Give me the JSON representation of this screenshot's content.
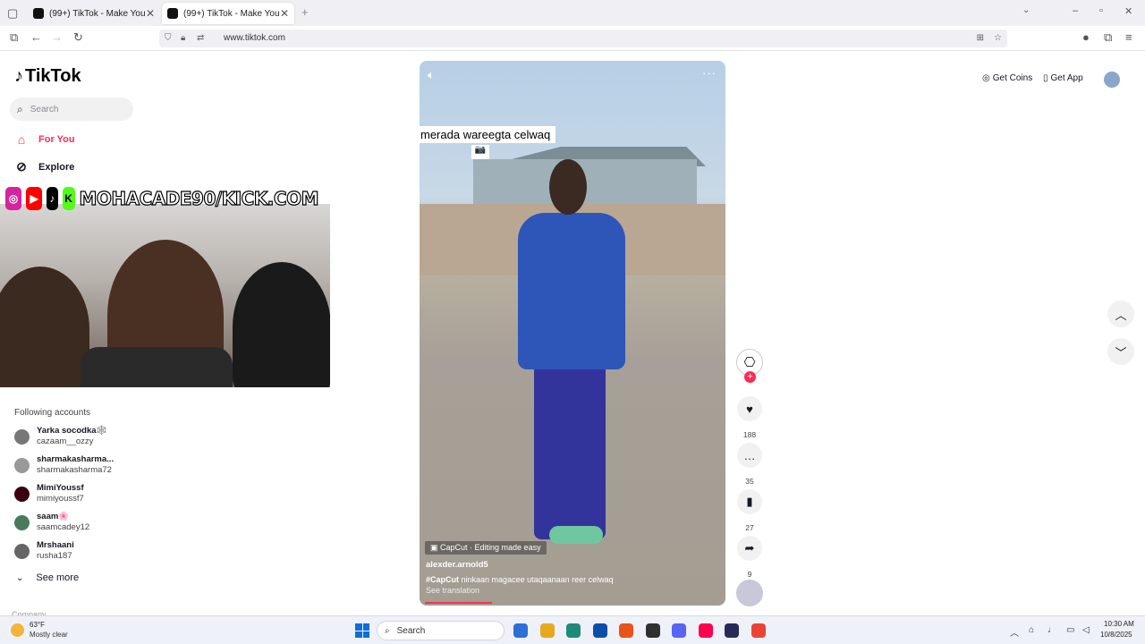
{
  "browser": {
    "tabs": [
      {
        "label": "(99+) TikTok - Make Your Day",
        "active": false
      },
      {
        "label": "(99+) TikTok - Make Your Day",
        "active": true
      }
    ],
    "new_tab": "+",
    "url": "www.tiktok.com"
  },
  "tiktok": {
    "logo": "TikTok",
    "search_placeholder": "Search",
    "nav": [
      {
        "label": "For You",
        "icon": "home-icon"
      },
      {
        "label": "Explore",
        "icon": "compass-icon"
      }
    ],
    "following_title": "Following accounts",
    "accounts": [
      {
        "display": "Yarka socodka🕸️",
        "user": "cazaam__ozzy",
        "color": "#777"
      },
      {
        "display": "sharmakasharma...",
        "user": "sharmakasharma72",
        "color": "#999"
      },
      {
        "display": "MimiYoussf",
        "user": "mimiyoussf7",
        "color": "#3a0010"
      },
      {
        "display": "saam🌸",
        "user": "saamcadey12",
        "color": "#4a7a5a"
      },
      {
        "display": "Mrshaani",
        "user": "rusha187",
        "color": "#666"
      }
    ],
    "see_more": "See more",
    "company": "Company",
    "get_coins": "Get Coins",
    "get_app": "Get App"
  },
  "stream_overlay": {
    "channel": "MOHACADE90/KICK.COM",
    "badges": [
      {
        "name": "instagram-icon",
        "glyph": "◎",
        "color": "#d6249f"
      },
      {
        "name": "youtube-icon",
        "glyph": "▶",
        "color": "#ff0000"
      },
      {
        "name": "tiktok-icon",
        "glyph": "♪",
        "color": "#000000"
      },
      {
        "name": "kick-icon",
        "glyph": "K",
        "color": "#53fc18"
      }
    ]
  },
  "video": {
    "overlay_text": "merada wareegta celwaq",
    "capcut_label": "CapCut · Editing made easy",
    "author": "alexder.arnold5",
    "hashtag": "#CapCut",
    "description": "ninkaan magacee utaqaanaan reer celwaq",
    "see_translation": "See translation",
    "progress_fraction": 0.22,
    "likes": "188",
    "comments": "35",
    "saves": "27",
    "shares": "9"
  },
  "taskbar": {
    "temperature": "63°F",
    "weather": "Mostly clear",
    "search": "Search",
    "time": "10:30 AM",
    "date": "10/8/2025",
    "apps": [
      "#2d6ed8",
      "#e8a820",
      "#1e8a7a",
      "#0c4fa8",
      "#e8541c",
      "#303030",
      "#5865f2",
      "#ff0050",
      "#2a2a5a",
      "#ea4335"
    ]
  },
  "colors": {
    "accent": "#fe2c55"
  }
}
